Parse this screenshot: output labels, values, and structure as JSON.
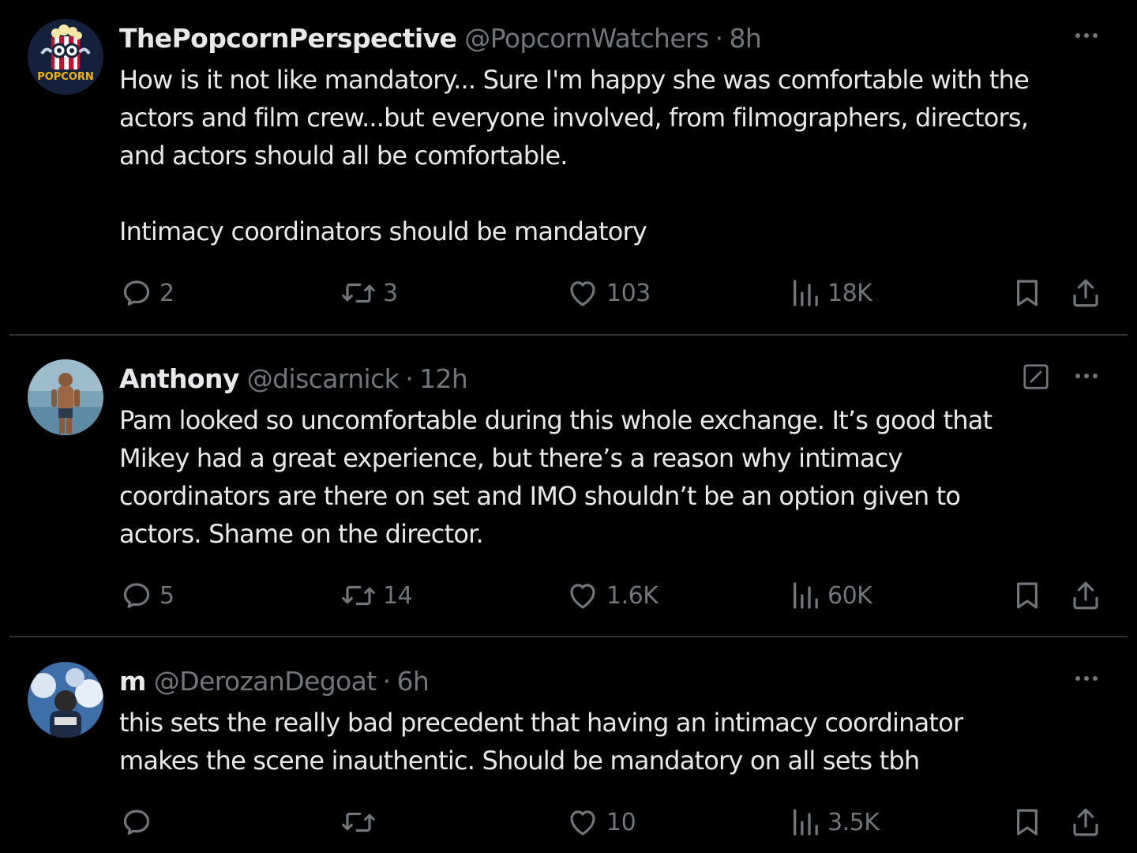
{
  "colors": {
    "background": "#000000",
    "text_primary": "#e7e9ea",
    "text_secondary": "#71767b",
    "divider": "#2f3336"
  },
  "tweets": [
    {
      "avatar": "popcorn-logo-avatar",
      "avatar_logo_text": "POPCORN",
      "display_name": "ThePopcornPerspective",
      "handle": "@PopcornWatchers",
      "separator": "·",
      "time": "8h",
      "edited": false,
      "text_lines": [
        "How is it not like mandatory... Sure I'm happy she was comfortable with the",
        "actors and film crew...but everyone involved, from filmographers, directors,",
        "and actors should all be comfortable."
      ],
      "text_lines_2": [
        "Intimacy coordinators should be mandatory"
      ],
      "replies": "2",
      "reposts": "3",
      "likes": "103",
      "views": "18K"
    },
    {
      "avatar": "person-photo-avatar",
      "display_name": "Anthony",
      "handle": "@discarnick",
      "separator": "·",
      "time": "12h",
      "edited": true,
      "text_lines": [
        "Pam looked so uncomfortable during this whole exchange. It’s good that",
        "Mikey had a great experience, but there’s a reason why intimacy",
        "coordinators are there on set and IMO shouldn’t be an option given to",
        "actors. Shame on the director."
      ],
      "replies": "5",
      "reposts": "14",
      "likes": "1.6K",
      "views": "60K"
    },
    {
      "avatar": "person-sky-avatar",
      "display_name": "m",
      "handle": "@DerozanDegoat",
      "separator": "·",
      "time": "6h",
      "edited": false,
      "text_lines": [
        "this sets the really bad precedent that having an intimacy coordinator",
        "makes the scene inauthentic. Should be mandatory on all sets tbh"
      ],
      "replies": "",
      "reposts": "",
      "likes": "10",
      "views": "3.5K"
    }
  ]
}
